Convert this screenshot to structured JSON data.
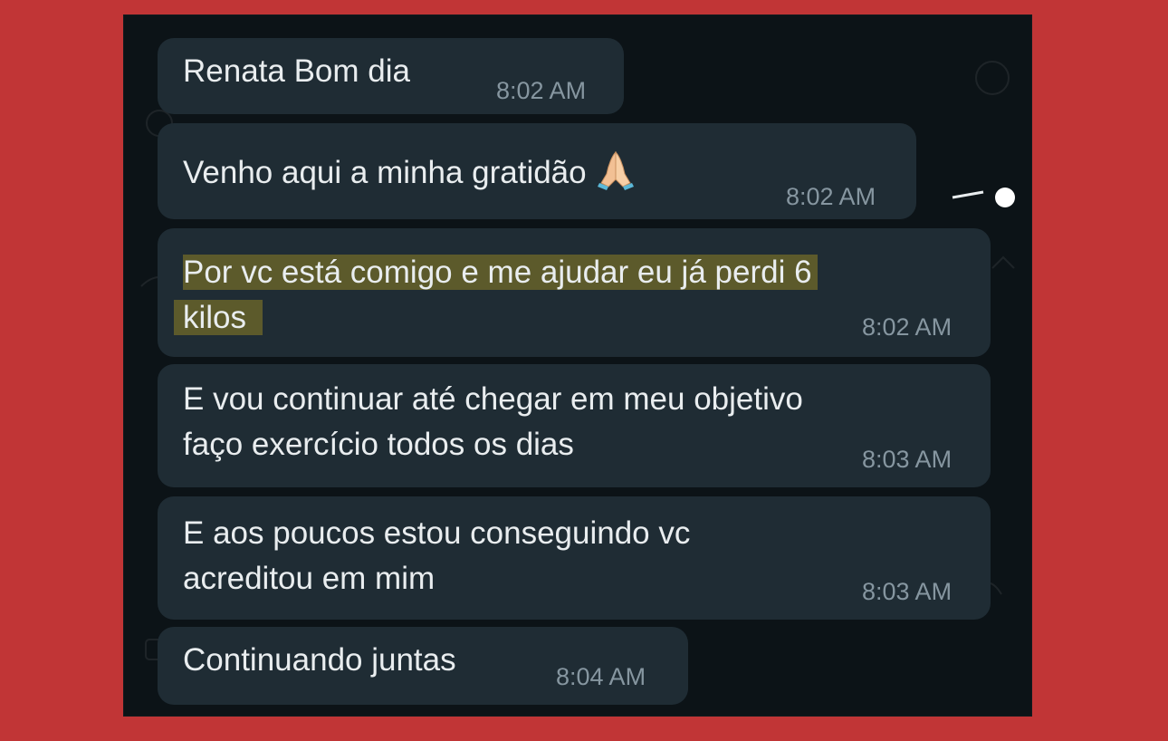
{
  "chat": {
    "messages": [
      {
        "text": "Renata Bom dia",
        "time": "8:02 AM"
      },
      {
        "text": "Venho aqui a minha gratidão",
        "emoji": "folded-hands-emoji",
        "time": "8:02 AM"
      },
      {
        "lines": [
          "Por vc está comigo e me ajudar eu já perdi 6",
          "kilos"
        ],
        "time": "8:02 AM",
        "highlight_color": "#5c5a2b"
      },
      {
        "lines": [
          "E vou continuar até chegar em meu objetivo",
          "faço exercício todos os dias"
        ],
        "time": "8:03 AM"
      },
      {
        "lines": [
          "E aos poucos estou conseguindo vc",
          "acreditou em mim"
        ],
        "time": "8:03 AM"
      },
      {
        "text": "Continuando juntas",
        "time": "8:04 AM"
      }
    ]
  },
  "colors": {
    "background": "#c13536",
    "chat_background": "#0c1317",
    "bubble": "#1f2c34",
    "text": "#e9edef",
    "timestamp": "#8696a0",
    "highlight": "#5c5a2b"
  }
}
